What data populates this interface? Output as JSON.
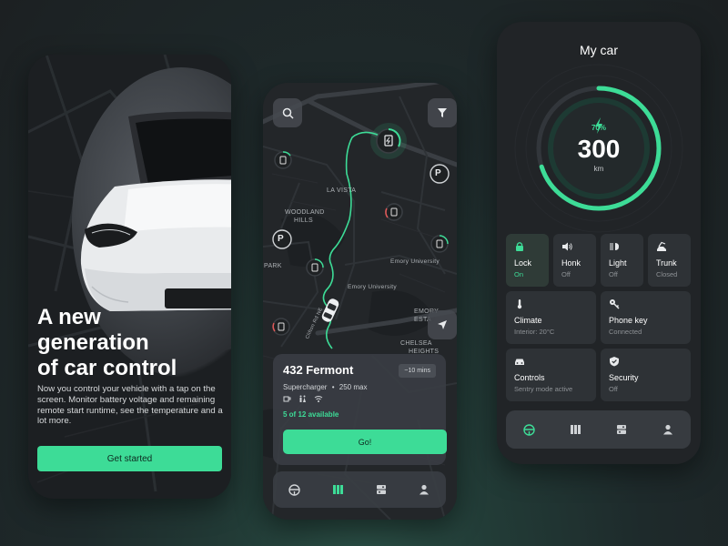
{
  "onboarding": {
    "headline_1": "A new",
    "headline_2": "generation",
    "headline_3": "of car control",
    "description": "Now you control your vehicle with a tap on the screen. Monitor battery voltage and remaining remote start runtime, see the temperature and a lot more.",
    "cta_label": "Get started"
  },
  "map": {
    "labels": [
      "LA VISTA",
      "WOODLAND",
      "HILLS",
      "PARK",
      "Emory University",
      "Emory University",
      "CHELSEA",
      "HEIGHTS",
      "EMORY",
      "ESTA",
      "Clifton Rd NE"
    ],
    "buttons": {
      "search": "search-icon",
      "filter": "filter-icon",
      "locate": "navigation-arrow-icon"
    },
    "station": {
      "address": "432 Fermont",
      "eta": "~10 mins",
      "type": "Supercharger",
      "separator": "•",
      "power": "250 max",
      "availability": "5 of 12 available",
      "go_label": "Go!"
    },
    "tabs": [
      {
        "icon": "steering-wheel-icon",
        "active": false
      },
      {
        "icon": "map-icon",
        "active": true
      },
      {
        "icon": "controls-icon",
        "active": false
      },
      {
        "icon": "profile-icon",
        "active": false
      }
    ]
  },
  "my_car": {
    "title": "My car",
    "battery_percent": "70%",
    "battery_level": 0.7,
    "range_value": "300",
    "range_unit": "km",
    "tiles": [
      {
        "label": "Lock",
        "status": "On",
        "icon": "lock-icon",
        "active": true
      },
      {
        "label": "Honk",
        "status": "Off",
        "icon": "speaker-icon",
        "active": false
      },
      {
        "label": "Light",
        "status": "Off",
        "icon": "headlight-icon",
        "active": false
      },
      {
        "label": "Trunk",
        "status": "Closed",
        "icon": "trunk-icon",
        "active": false
      },
      {
        "label": "Climate",
        "status": "Interior: 20°C",
        "icon": "thermometer-icon",
        "active": false
      },
      {
        "label": "Phone key",
        "status": "Connected",
        "icon": "key-icon",
        "active": false
      },
      {
        "label": "Controls",
        "status": "Sentry mode active",
        "icon": "car-icon",
        "active": false
      },
      {
        "label": "Security",
        "status": "Off",
        "icon": "shield-icon",
        "active": false
      }
    ],
    "tabs": [
      {
        "icon": "steering-wheel-icon",
        "active": true
      },
      {
        "icon": "map-icon",
        "active": false
      },
      {
        "icon": "controls-icon",
        "active": false
      },
      {
        "icon": "profile-icon",
        "active": false
      }
    ]
  },
  "colors": {
    "accent": "#3ddc97",
    "card": "#2e3236",
    "background": "#1e2a2b"
  }
}
